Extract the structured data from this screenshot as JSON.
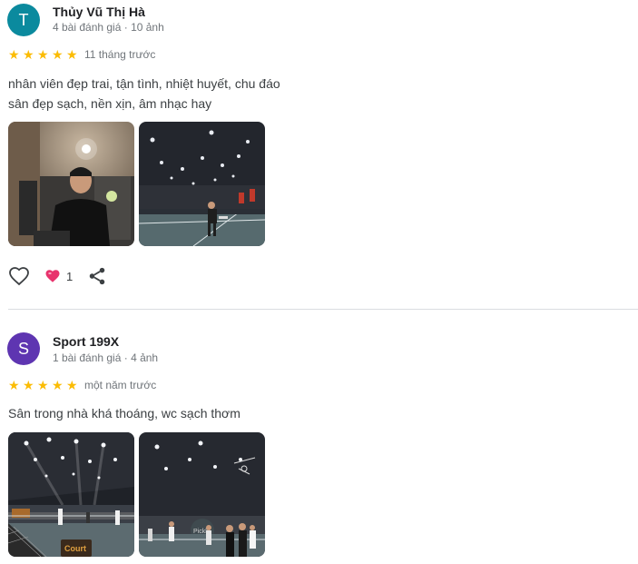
{
  "reviews": [
    {
      "avatar_letter": "T",
      "avatar_color": "#0b8a9e",
      "name": "Thủy Vũ Thị Hà",
      "meta": "4 bài đánh giá · 10 ảnh",
      "rating": 5,
      "time": "11 tháng trước",
      "text_lines": [
        "nhân viên đẹp trai, tận tình, nhiệt huyết, chu đáo",
        "sân đẹp sạch, nền xịn, âm nhạc hay"
      ],
      "photos": [
        "photo-man-in-lobby",
        "photo-indoor-court-player"
      ],
      "reactions": {
        "heart_count": "1"
      }
    },
    {
      "avatar_letter": "S",
      "avatar_color": "#5e35b1",
      "name": "Sport 199X",
      "meta": "1 bài đánh giá · 4 ảnh",
      "rating": 5,
      "time": "một năm trước",
      "text_lines": [
        "Sân trong nhà khá thoáng, wc sạch thơm"
      ],
      "photos": [
        "photo-indoor-courts-lights",
        "photo-indoor-court-players"
      ]
    }
  ],
  "icons": {
    "like": "heart-outline-icon",
    "reaction": "heart-emoji-icon",
    "share": "share-icon",
    "star": "star-icon"
  }
}
